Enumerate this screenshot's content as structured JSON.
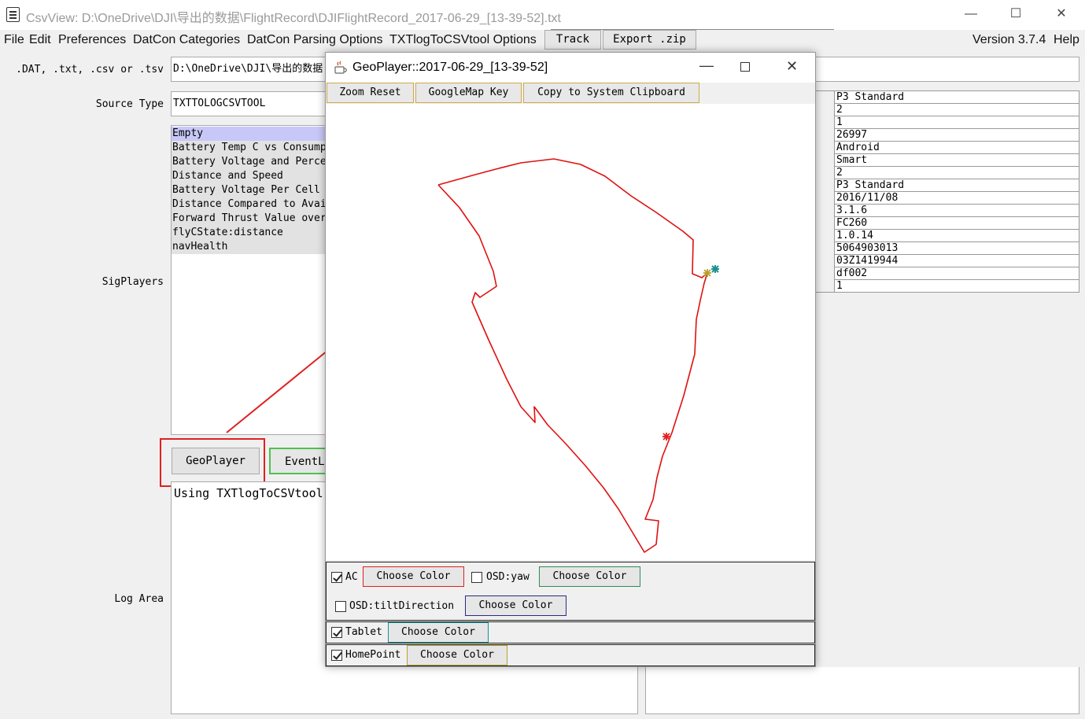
{
  "window": {
    "title": "CsvView: D:\\OneDrive\\DJI\\导出的数据\\FlightRecord\\DJIFlightRecord_2017-06-29_[13-39-52].txt",
    "minimize": "—",
    "maximize": "☐",
    "close": "✕"
  },
  "menu": {
    "items": [
      "File",
      "Edit",
      "Preferences",
      "DatCon Categories",
      "DatCon Parsing Options",
      "TXTlogToCSVtool Options"
    ],
    "track_button": "Track",
    "export_button": "Export .zip",
    "version": "Version 3.7.4",
    "help": "Help"
  },
  "form": {
    "file_label": ".DAT, .txt, .csv or .tsv",
    "file_value": "D:\\OneDrive\\DJI\\导出的数据",
    "source_type_label": "Source Type",
    "source_type_value": "TXTTOLOGCSVTOOL",
    "sigplayers_label": "SigPlayers",
    "sigplayers": [
      "Empty",
      "Battery Temp C vs Consump",
      "Battery Voltage and Perce",
      "Distance and Speed",
      "Battery Voltage Per Cell",
      "Distance Compared to Avai",
      "Forward Thrust Value over",
      "flyCState:distance",
      "navHealth"
    ],
    "geoplayer_button": "GeoPlayer",
    "eventlog_button": "EventLo",
    "log_area_label": "Log Area",
    "log_text": "Using TXTlogToCSVtool"
  },
  "info_values": [
    "P3 Standard",
    "2",
    "1",
    "26997",
    "Android",
    "Smart",
    "2",
    "P3 Standard",
    "2016/11/08",
    "3.1.6",
    "FC260",
    "1.0.14",
    "5064903013",
    "03Z1419944",
    "df002",
    "1"
  ],
  "geo": {
    "title": "GeoPlayer::2017-06-29_[13-39-52]",
    "zoom_reset": "Zoom Reset",
    "googlemap_key": "GoogleMap Key",
    "copy_clipboard": "Copy to System Clipboard",
    "ac_label": "AC",
    "ac_checked": true,
    "ac_color_button": "Choose Color",
    "osd_yaw_label": "OSD:yaw",
    "osd_yaw_checked": false,
    "osd_yaw_color_button": "Choose Color",
    "osd_tilt_label": "OSD:tiltDirection",
    "osd_tilt_checked": false,
    "osd_tilt_color_button": "Choose Color",
    "tablet_label": "Tablet",
    "tablet_checked": true,
    "tablet_color_button": "Choose Color",
    "homepoint_label": "HomePoint",
    "homepoint_checked": true,
    "homepoint_color_button": "Choose Color",
    "colors": {
      "ac": "#e0201f",
      "osd_yaw": "#2e8b57",
      "osd_tilt": "#2a2a80",
      "tablet": "#1a9090",
      "homepoint": "#b8a030",
      "track": "#e01010"
    }
  }
}
